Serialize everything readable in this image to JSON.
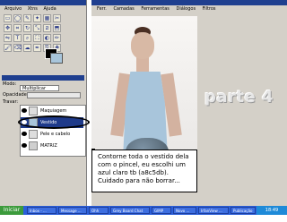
{
  "toolbox": {
    "menus": [
      "Arquivo",
      "Xtns",
      "Ajuda"
    ],
    "tools": [
      "rect-select",
      "ellipse-select",
      "free-select",
      "fuzzy-select",
      "color-select",
      "scissors",
      "move",
      "crop",
      "rotate",
      "scale",
      "shear",
      "perspective",
      "flip",
      "text",
      "color-picker",
      "bucket-fill",
      "blend",
      "pencil",
      "paintbrush",
      "eraser",
      "airbrush",
      "ink",
      "clone",
      "heal"
    ],
    "fg_color": "#000000",
    "bg_color": "#a8c5db",
    "mode_label": "Modo:",
    "mode_value": "Multiplicar",
    "opacity_label": "Opacidade:",
    "lock_label": "Travar:",
    "layers": [
      {
        "name": "Maquiagem"
      },
      {
        "name": "Vestido"
      },
      {
        "name": "Pele e cabelo"
      },
      {
        "name": "MATRIZ"
      }
    ]
  },
  "canvas_window": {
    "menus": [
      "Ferr.",
      "Camadas",
      "Ferramentas",
      "Diálogos",
      "Filtros"
    ]
  },
  "watermark": "parte 4",
  "callout_text": "Contorne toda o vestido dela com o pincel, eu escolhi um azul claro tb (a8c5db). Cuidado para não borrar...",
  "taskbar": {
    "start": "Iniciar",
    "tasks": [
      "Inbox - ...",
      "Message ...",
      "Ohh",
      "Grey Board Chat ...",
      "GIMP",
      "Novo ...",
      "IrfanView ...",
      "Publicação - Me..."
    ],
    "clock": "18:49"
  }
}
